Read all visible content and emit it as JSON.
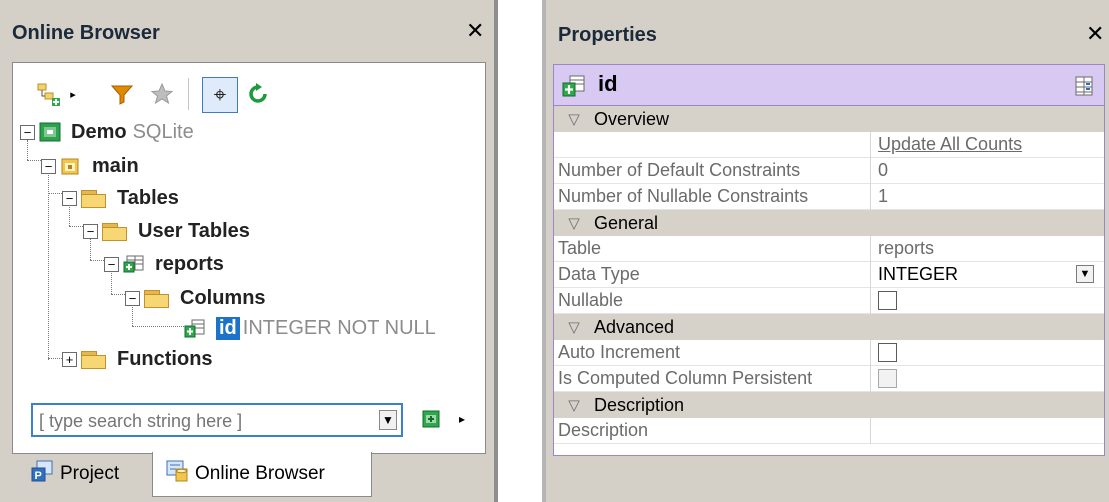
{
  "left_panel": {
    "title": "Online Browser",
    "tree": {
      "demo": {
        "name": "Demo",
        "type": "SQLite"
      },
      "main": "main",
      "tables": "Tables",
      "user_tables": "User Tables",
      "reports": "reports",
      "columns": "Columns",
      "id_name": "id",
      "id_type": "INTEGER NOT NULL",
      "functions": "Functions"
    },
    "search": {
      "placeholder": "[ type search string here ]"
    },
    "tabs": {
      "project": "Project",
      "online_browser": "Online Browser"
    }
  },
  "right_panel": {
    "title": "Properties",
    "object_name": "id",
    "sections": {
      "overview": "Overview",
      "general": "General",
      "advanced": "Advanced",
      "description": "Description"
    },
    "overview": {
      "update_link": "Update All Counts",
      "default_constraints_label": "Number of Default Constraints",
      "default_constraints_value": "0",
      "nullable_constraints_label": "Number of Nullable Constraints",
      "nullable_constraints_value": "1"
    },
    "general": {
      "table_label": "Table",
      "table_value": "reports",
      "data_type_label": "Data Type",
      "data_type_value": "INTEGER",
      "nullable_label": "Nullable",
      "nullable_checked": false
    },
    "advanced": {
      "auto_increment_label": "Auto Increment",
      "auto_increment_checked": false,
      "computed_persistent_label": "Is Computed Column Persistent",
      "computed_persistent_checked": false
    },
    "description": {
      "description_label": "Description",
      "description_value": ""
    }
  },
  "colors": {
    "selection": "#1c73c9",
    "accent_header": "#d8c9f2",
    "refresh_green": "#1e9a3a",
    "filter_orange": "#e08a00"
  }
}
